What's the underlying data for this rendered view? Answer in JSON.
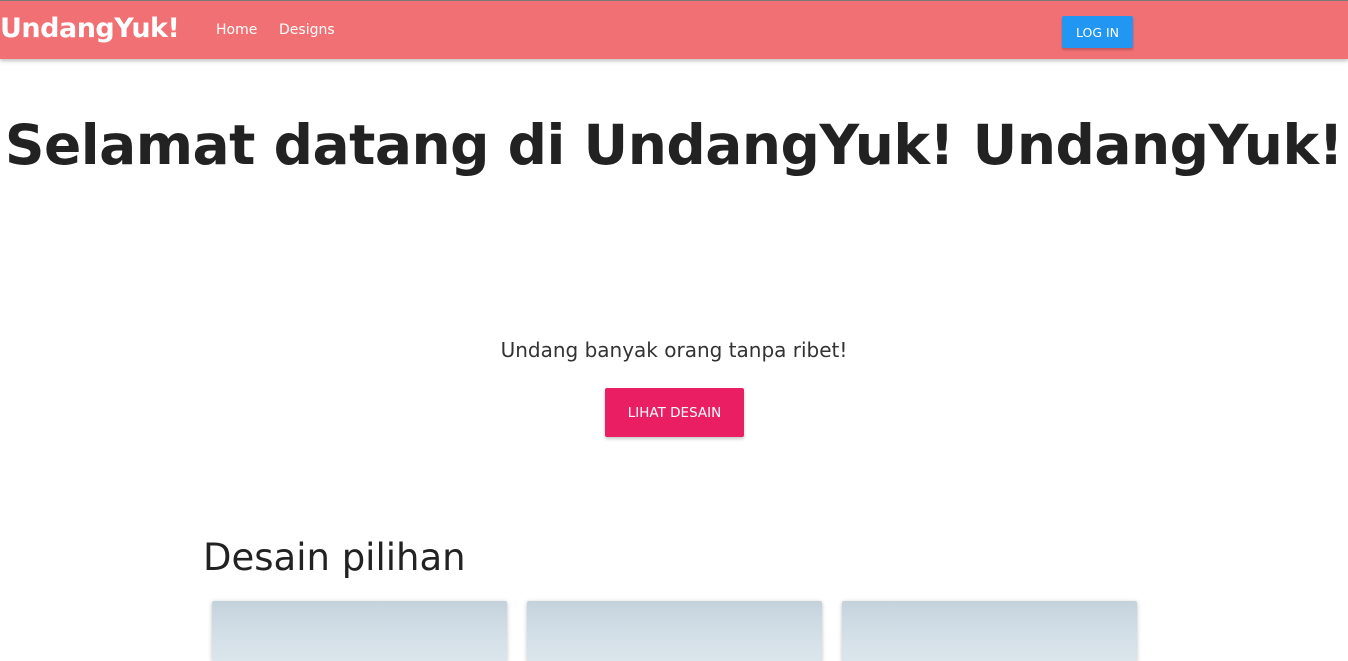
{
  "navbar": {
    "brand": "UndangYuk!",
    "links": [
      "Home",
      "Designs"
    ],
    "login_label": "LOG IN",
    "colors": {
      "background": "#f07074",
      "login": "#2196f3"
    }
  },
  "hero": {
    "title": "Selamat datang di UndangYuk! UndangYuk!",
    "tagline": "Undang banyak orang tanpa ribet!",
    "cta_label": "LIHAT DESAIN",
    "cta_color": "#e91e63"
  },
  "featured": {
    "title": "Desain pilihan",
    "cards": [
      {
        "image": "design-preview-image"
      },
      {
        "image": "design-preview-image"
      },
      {
        "image": "design-preview-image"
      }
    ]
  }
}
